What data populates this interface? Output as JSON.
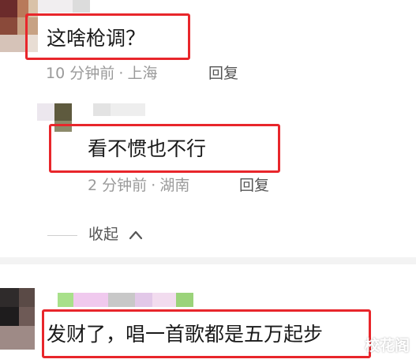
{
  "comments": [
    {
      "text": "这啥枪调？",
      "time": "10 分钟前",
      "location": "上海",
      "reply_label": "回复",
      "replies": [
        {
          "text": "看不惯也不行",
          "time": "2 分钟前",
          "location": "湖南",
          "reply_label": "回复"
        }
      ],
      "collapse_label": "收起"
    },
    {
      "text": "发财了，唱一首歌都是五万起步"
    }
  ],
  "meta_separator": "·",
  "watermark": "校花阁",
  "colors": {
    "highlight": "#e8262b",
    "meta_text": "#9a9a9a",
    "divider": "#f3f3f3"
  },
  "icons": {
    "collapse": "chevron-up-icon"
  }
}
